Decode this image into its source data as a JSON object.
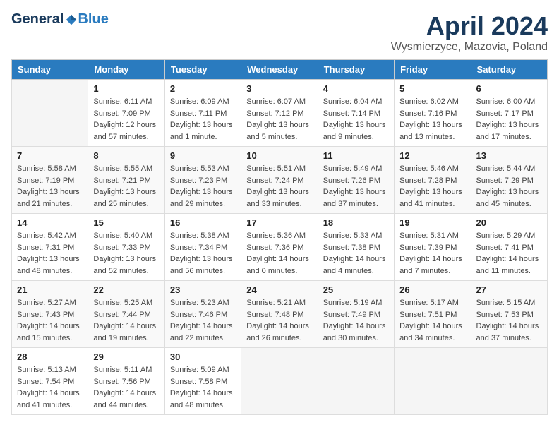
{
  "header": {
    "logo_general": "General",
    "logo_blue": "Blue",
    "month_title": "April 2024",
    "location": "Wysmierzyce, Mazovia, Poland"
  },
  "days_of_week": [
    "Sunday",
    "Monday",
    "Tuesday",
    "Wednesday",
    "Thursday",
    "Friday",
    "Saturday"
  ],
  "weeks": [
    [
      {
        "day": "",
        "sunrise": "",
        "sunset": "",
        "daylight": ""
      },
      {
        "day": "1",
        "sunrise": "Sunrise: 6:11 AM",
        "sunset": "Sunset: 7:09 PM",
        "daylight": "Daylight: 12 hours and 57 minutes."
      },
      {
        "day": "2",
        "sunrise": "Sunrise: 6:09 AM",
        "sunset": "Sunset: 7:11 PM",
        "daylight": "Daylight: 13 hours and 1 minute."
      },
      {
        "day": "3",
        "sunrise": "Sunrise: 6:07 AM",
        "sunset": "Sunset: 7:12 PM",
        "daylight": "Daylight: 13 hours and 5 minutes."
      },
      {
        "day": "4",
        "sunrise": "Sunrise: 6:04 AM",
        "sunset": "Sunset: 7:14 PM",
        "daylight": "Daylight: 13 hours and 9 minutes."
      },
      {
        "day": "5",
        "sunrise": "Sunrise: 6:02 AM",
        "sunset": "Sunset: 7:16 PM",
        "daylight": "Daylight: 13 hours and 13 minutes."
      },
      {
        "day": "6",
        "sunrise": "Sunrise: 6:00 AM",
        "sunset": "Sunset: 7:17 PM",
        "daylight": "Daylight: 13 hours and 17 minutes."
      }
    ],
    [
      {
        "day": "7",
        "sunrise": "Sunrise: 5:58 AM",
        "sunset": "Sunset: 7:19 PM",
        "daylight": "Daylight: 13 hours and 21 minutes."
      },
      {
        "day": "8",
        "sunrise": "Sunrise: 5:55 AM",
        "sunset": "Sunset: 7:21 PM",
        "daylight": "Daylight: 13 hours and 25 minutes."
      },
      {
        "day": "9",
        "sunrise": "Sunrise: 5:53 AM",
        "sunset": "Sunset: 7:23 PM",
        "daylight": "Daylight: 13 hours and 29 minutes."
      },
      {
        "day": "10",
        "sunrise": "Sunrise: 5:51 AM",
        "sunset": "Sunset: 7:24 PM",
        "daylight": "Daylight: 13 hours and 33 minutes."
      },
      {
        "day": "11",
        "sunrise": "Sunrise: 5:49 AM",
        "sunset": "Sunset: 7:26 PM",
        "daylight": "Daylight: 13 hours and 37 minutes."
      },
      {
        "day": "12",
        "sunrise": "Sunrise: 5:46 AM",
        "sunset": "Sunset: 7:28 PM",
        "daylight": "Daylight: 13 hours and 41 minutes."
      },
      {
        "day": "13",
        "sunrise": "Sunrise: 5:44 AM",
        "sunset": "Sunset: 7:29 PM",
        "daylight": "Daylight: 13 hours and 45 minutes."
      }
    ],
    [
      {
        "day": "14",
        "sunrise": "Sunrise: 5:42 AM",
        "sunset": "Sunset: 7:31 PM",
        "daylight": "Daylight: 13 hours and 48 minutes."
      },
      {
        "day": "15",
        "sunrise": "Sunrise: 5:40 AM",
        "sunset": "Sunset: 7:33 PM",
        "daylight": "Daylight: 13 hours and 52 minutes."
      },
      {
        "day": "16",
        "sunrise": "Sunrise: 5:38 AM",
        "sunset": "Sunset: 7:34 PM",
        "daylight": "Daylight: 13 hours and 56 minutes."
      },
      {
        "day": "17",
        "sunrise": "Sunrise: 5:36 AM",
        "sunset": "Sunset: 7:36 PM",
        "daylight": "Daylight: 14 hours and 0 minutes."
      },
      {
        "day": "18",
        "sunrise": "Sunrise: 5:33 AM",
        "sunset": "Sunset: 7:38 PM",
        "daylight": "Daylight: 14 hours and 4 minutes."
      },
      {
        "day": "19",
        "sunrise": "Sunrise: 5:31 AM",
        "sunset": "Sunset: 7:39 PM",
        "daylight": "Daylight: 14 hours and 7 minutes."
      },
      {
        "day": "20",
        "sunrise": "Sunrise: 5:29 AM",
        "sunset": "Sunset: 7:41 PM",
        "daylight": "Daylight: 14 hours and 11 minutes."
      }
    ],
    [
      {
        "day": "21",
        "sunrise": "Sunrise: 5:27 AM",
        "sunset": "Sunset: 7:43 PM",
        "daylight": "Daylight: 14 hours and 15 minutes."
      },
      {
        "day": "22",
        "sunrise": "Sunrise: 5:25 AM",
        "sunset": "Sunset: 7:44 PM",
        "daylight": "Daylight: 14 hours and 19 minutes."
      },
      {
        "day": "23",
        "sunrise": "Sunrise: 5:23 AM",
        "sunset": "Sunset: 7:46 PM",
        "daylight": "Daylight: 14 hours and 22 minutes."
      },
      {
        "day": "24",
        "sunrise": "Sunrise: 5:21 AM",
        "sunset": "Sunset: 7:48 PM",
        "daylight": "Daylight: 14 hours and 26 minutes."
      },
      {
        "day": "25",
        "sunrise": "Sunrise: 5:19 AM",
        "sunset": "Sunset: 7:49 PM",
        "daylight": "Daylight: 14 hours and 30 minutes."
      },
      {
        "day": "26",
        "sunrise": "Sunrise: 5:17 AM",
        "sunset": "Sunset: 7:51 PM",
        "daylight": "Daylight: 14 hours and 34 minutes."
      },
      {
        "day": "27",
        "sunrise": "Sunrise: 5:15 AM",
        "sunset": "Sunset: 7:53 PM",
        "daylight": "Daylight: 14 hours and 37 minutes."
      }
    ],
    [
      {
        "day": "28",
        "sunrise": "Sunrise: 5:13 AM",
        "sunset": "Sunset: 7:54 PM",
        "daylight": "Daylight: 14 hours and 41 minutes."
      },
      {
        "day": "29",
        "sunrise": "Sunrise: 5:11 AM",
        "sunset": "Sunset: 7:56 PM",
        "daylight": "Daylight: 14 hours and 44 minutes."
      },
      {
        "day": "30",
        "sunrise": "Sunrise: 5:09 AM",
        "sunset": "Sunset: 7:58 PM",
        "daylight": "Daylight: 14 hours and 48 minutes."
      },
      {
        "day": "",
        "sunrise": "",
        "sunset": "",
        "daylight": ""
      },
      {
        "day": "",
        "sunrise": "",
        "sunset": "",
        "daylight": ""
      },
      {
        "day": "",
        "sunrise": "",
        "sunset": "",
        "daylight": ""
      },
      {
        "day": "",
        "sunrise": "",
        "sunset": "",
        "daylight": ""
      }
    ]
  ]
}
